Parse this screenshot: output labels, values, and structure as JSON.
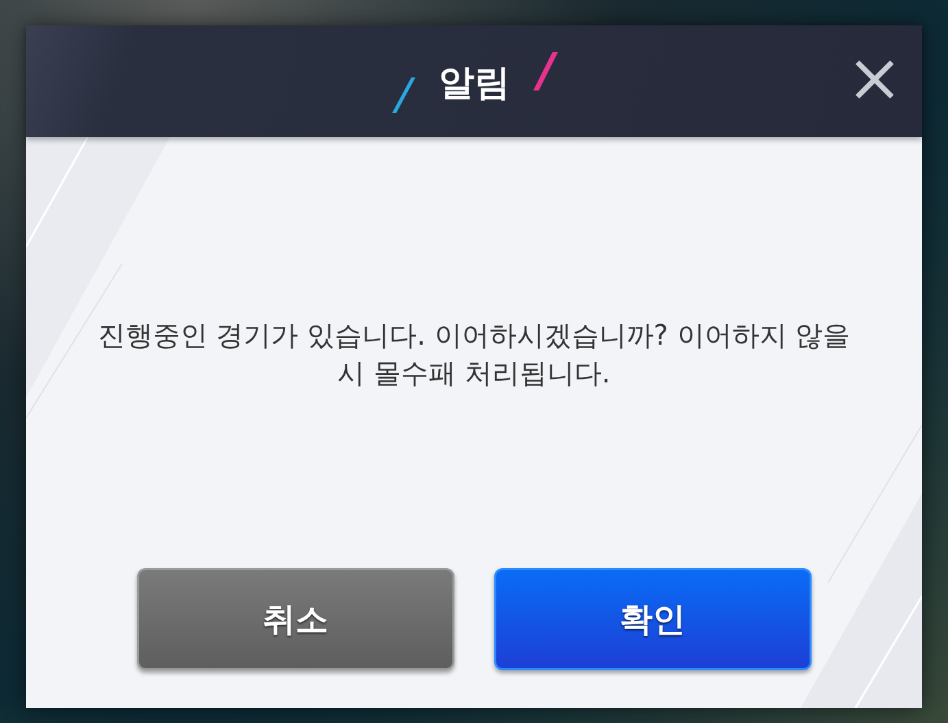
{
  "dialog": {
    "title": "알림",
    "message": "진행중인 경기가 있습니다. 이어하시겠습니까? 이어하지 않을시 몰수패 처리됩니다.",
    "buttons": [
      {
        "label": "취소",
        "kind": "secondary"
      },
      {
        "label": "확인",
        "kind": "primary"
      }
    ]
  }
}
